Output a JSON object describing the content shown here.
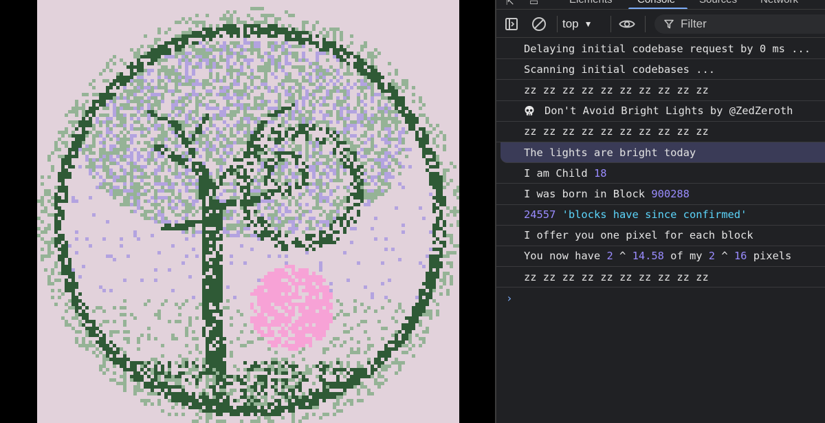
{
  "devtools": {
    "tabs": [
      {
        "label": "Elements",
        "active": false
      },
      {
        "label": "Console",
        "active": true
      },
      {
        "label": "Sources",
        "active": false
      },
      {
        "label": "Network",
        "active": false
      }
    ],
    "toolbar": {
      "context": "top",
      "filter_placeholder": "Filter"
    },
    "console": {
      "messages": [
        {
          "parts": [
            {
              "t": "text",
              "v": "Delaying initial codebase request by 0 ms ..."
            }
          ]
        },
        {
          "parts": [
            {
              "t": "text",
              "v": "Scanning initial codebases ..."
            }
          ]
        },
        {
          "parts": [
            {
              "t": "text",
              "v": "zz zz zz zz zz zz zz zz zz zz"
            }
          ]
        },
        {
          "icon": "skull-icon",
          "parts": [
            {
              "t": "text",
              "v": "Don't Avoid Bright Lights by @ZedZeroth"
            }
          ]
        },
        {
          "parts": [
            {
              "t": "text",
              "v": "zz zz zz zz zz zz zz zz zz zz"
            }
          ]
        },
        {
          "selected": true,
          "parts": [
            {
              "t": "text",
              "v": "The lights are bright today"
            }
          ]
        },
        {
          "parts": [
            {
              "t": "text",
              "v": "I am Child "
            },
            {
              "t": "num",
              "v": "18"
            }
          ]
        },
        {
          "parts": [
            {
              "t": "text",
              "v": "I was born in Block "
            },
            {
              "t": "num",
              "v": "900288"
            }
          ]
        },
        {
          "parts": [
            {
              "t": "num",
              "v": "24557"
            },
            {
              "t": "text",
              "v": " "
            },
            {
              "t": "str",
              "v": "'blocks have since confirmed'"
            }
          ]
        },
        {
          "parts": [
            {
              "t": "text",
              "v": "I offer you one pixel for each block"
            }
          ]
        },
        {
          "parts": [
            {
              "t": "text",
              "v": "You now have "
            },
            {
              "t": "num",
              "v": "2"
            },
            {
              "t": "text",
              "v": " ^ "
            },
            {
              "t": "num",
              "v": "14.58"
            },
            {
              "t": "text",
              "v": " of my "
            },
            {
              "t": "num",
              "v": "2"
            },
            {
              "t": "text",
              "v": " ^ "
            },
            {
              "t": "num",
              "v": "16"
            },
            {
              "t": "text",
              "v": " pixels"
            }
          ]
        },
        {
          "parts": [
            {
              "t": "text",
              "v": "zz zz zz zz zz zz zz zz zz zz"
            }
          ]
        }
      ],
      "prompt_symbol": "›"
    }
  },
  "artwork": {
    "background": "#e2d2db",
    "colors": {
      "dark_green": "#2f5a36",
      "light_green": "#95b396",
      "lavender": "#b3a3e0",
      "pink": "#f7a2d6"
    }
  },
  "theme": {
    "number_color": "#9a8cff",
    "string_color": "#5cd5fb",
    "accent": "#7cacf8"
  }
}
